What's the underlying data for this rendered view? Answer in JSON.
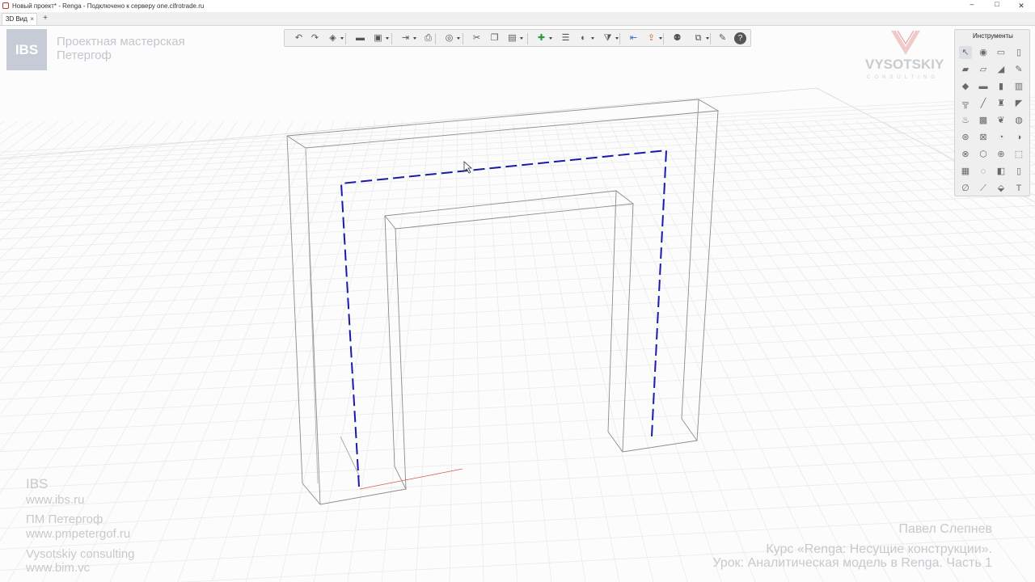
{
  "window": {
    "title": "Новый проект* - Renga - Подключено к серверу one.cifrotrade.ru",
    "controls": {
      "minimize": "–",
      "maximize": "□",
      "close": "✕"
    }
  },
  "tabs": [
    {
      "label": "3D Вид",
      "close": "×"
    }
  ],
  "tab_add": "+",
  "branding": {
    "ibs_logo": "IBS",
    "studio_line1": "Проектная мастерская",
    "studio_line2": "Петергоф",
    "vysotskiy": "VYSOTSKIY",
    "vysotskiy_sub": "CONSULTING"
  },
  "toolbar": {
    "items": [
      {
        "name": "undo-icon",
        "glyph": "↶"
      },
      {
        "name": "redo-icon",
        "glyph": "↷"
      },
      {
        "name": "3d-box-icon",
        "glyph": "◈"
      },
      {
        "name": "open-folder-icon",
        "glyph": "▬"
      },
      {
        "name": "save-icon",
        "glyph": "▣"
      },
      {
        "name": "export-icon",
        "glyph": "⇥"
      },
      {
        "name": "print-icon",
        "glyph": "⎙"
      },
      {
        "name": "view-orbit-icon",
        "glyph": "◎"
      },
      {
        "name": "cut-icon",
        "glyph": "✂"
      },
      {
        "name": "copy-icon",
        "glyph": "❐"
      },
      {
        "name": "paste-icon",
        "glyph": "▤"
      },
      {
        "name": "add-green-icon",
        "glyph": "✚"
      },
      {
        "name": "list-icon",
        "glyph": "☰"
      },
      {
        "name": "paint-icon",
        "glyph": "◐"
      },
      {
        "name": "filter-icon",
        "glyph": "⧩"
      },
      {
        "name": "level-down-icon",
        "glyph": "⇤"
      },
      {
        "name": "level-up-icon",
        "glyph": "⇪"
      },
      {
        "name": "people-icon",
        "glyph": "⚉"
      },
      {
        "name": "layers-icon",
        "glyph": "⧉"
      },
      {
        "name": "settings-wrench-icon",
        "glyph": "✎"
      },
      {
        "name": "help-icon",
        "glyph": "?"
      }
    ]
  },
  "tools_panel": {
    "title": "Инструменты",
    "tools": [
      "select-icon",
      "level-icon",
      "room-icon",
      "column-icon",
      "beam-icon",
      "slab-icon",
      "roof-icon",
      "pencil-icon",
      "wall-icon",
      "floor-icon",
      "door-icon",
      "window-icon",
      "railing-icon",
      "line-icon",
      "stair-icon",
      "ramp-icon",
      "equipment-icon",
      "opening-icon",
      "plant-icon",
      "element-icon",
      "pipe-icon",
      "duct-icon",
      "fitting-icon",
      "valve-icon",
      "mep-icon",
      "mep2-icon",
      "mep3-icon",
      "mep4-icon",
      "panel-icon",
      "light-icon",
      "switch-icon",
      "socket-icon",
      "dimension-icon",
      "elevation-icon",
      "hatch-icon",
      "text-icon"
    ],
    "glyphs": [
      "↖",
      "◉",
      "▭",
      "▯",
      "▰",
      "▱",
      "◢",
      "✎",
      "◆",
      "▬",
      "▮",
      "▥",
      "╦",
      "╱",
      "♜",
      "◤",
      "♨",
      "▩",
      "❦",
      "◍",
      "⊛",
      "⊠",
      "◔",
      "◑",
      "⊗",
      "⬡",
      "⊕",
      "⬚",
      "▦",
      "◌",
      "◧",
      "▯",
      "∅",
      "⟋",
      "⬙",
      "T"
    ]
  },
  "watermark_left": {
    "ibs": "IBS",
    "ibs_url": "www.ibs.ru",
    "pm": "ПМ Петергоф",
    "pm_url": "www.pmpetergof.ru",
    "vc": "Vysotskiy consulting",
    "vc_url": "www.bim.vc"
  },
  "watermark_right": {
    "author": "Павел Слепнев",
    "course": "Курс «Renga: Несущие конструкции».",
    "lesson": "Урок: Аналитическая модель в Renga. Часть 1"
  },
  "colors": {
    "analytic_line": "#1a1aa8",
    "model_edge": "#8c8c8c",
    "grid_line": "#e6e6e6",
    "axis_red": "#e05050",
    "watermark": "#c7c9ce"
  }
}
